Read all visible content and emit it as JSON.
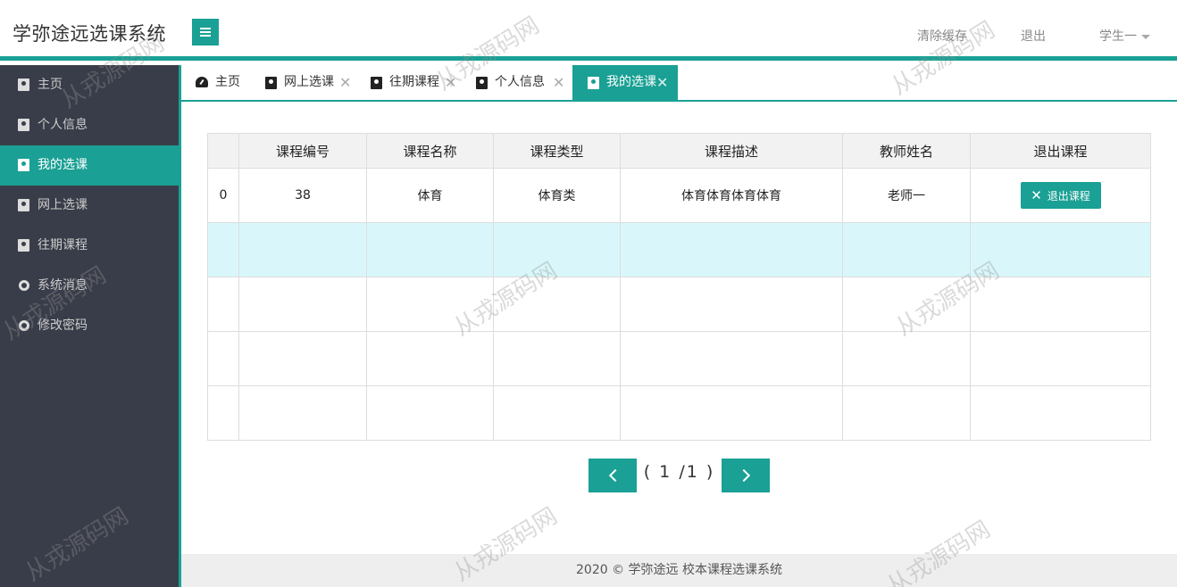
{
  "app": {
    "title": "学弥途远选课系统"
  },
  "header": {
    "clear_cache": "清除缓存",
    "logout": "退出",
    "user": "学生一"
  },
  "sidebar": {
    "items": [
      {
        "label": "主页",
        "icon": "contact-card-icon"
      },
      {
        "label": "个人信息",
        "icon": "contact-card-icon"
      },
      {
        "label": "我的选课",
        "icon": "contact-card-icon",
        "active": true
      },
      {
        "label": "网上选课",
        "icon": "contact-card-icon"
      },
      {
        "label": "往期课程",
        "icon": "contact-card-icon"
      },
      {
        "label": "系统消息",
        "icon": "circle-icon"
      },
      {
        "label": "修改密码",
        "icon": "circle-icon"
      }
    ]
  },
  "tabs": [
    {
      "label": "主页",
      "icon": "dashboard-icon",
      "closable": false
    },
    {
      "label": "网上选课",
      "icon": "contact-card-icon",
      "closable": true
    },
    {
      "label": "往期课程",
      "icon": "contact-card-icon",
      "closable": true
    },
    {
      "label": "个人信息",
      "icon": "contact-card-icon",
      "closable": true
    },
    {
      "label": "我的选课",
      "icon": "contact-card-icon",
      "closable": true,
      "active": true
    }
  ],
  "table": {
    "columns": [
      "",
      "课程编号",
      "课程名称",
      "课程类型",
      "课程描述",
      "教师姓名",
      "退出课程"
    ],
    "rows": [
      {
        "index": "0",
        "course_id": "38",
        "course_name": "体育",
        "course_type": "体育类",
        "course_desc": "体育体育体育体育",
        "teacher": "老师一",
        "action": "退出课程"
      }
    ]
  },
  "pager": {
    "text": "( 1 /1 )"
  },
  "footer": {
    "text": "2020 ©  学弥途远  校本课程选课系统"
  },
  "watermark": "从戎源码网",
  "colors": {
    "accent": "#1aa094",
    "sidebar_bg": "#393d49",
    "highlight_row": "#d9f7fa"
  }
}
